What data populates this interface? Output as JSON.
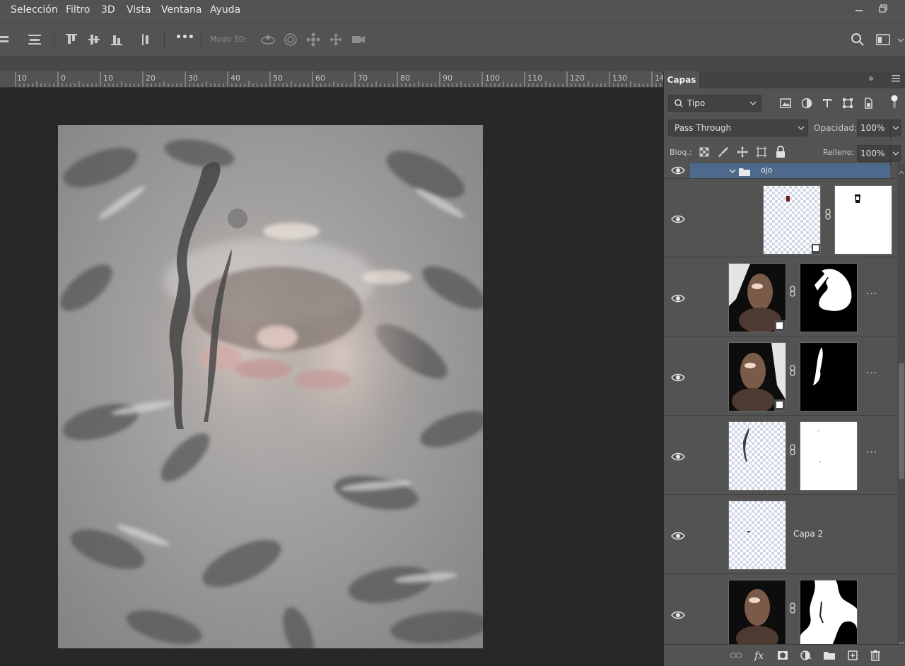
{
  "menu": {
    "items": [
      "Selección",
      "Filtro",
      "3D",
      "Vista",
      "Ventana",
      "Ayuda"
    ]
  },
  "window_controls": [
    "minimize-icon",
    "restore-icon"
  ],
  "options_bar": {
    "mode3d_label": "Modo 3D:",
    "more_label": "•••"
  },
  "ruler": {
    "labels": [
      "10",
      "0",
      "10",
      "20",
      "30",
      "40",
      "50",
      "60",
      "70",
      "80",
      "90",
      "100",
      "110",
      "120",
      "130",
      "14"
    ]
  },
  "layers_panel": {
    "tab_label": "Capas",
    "collapse_label": "»",
    "filter_label": "Tipo",
    "blend_mode": "Pass Through",
    "opacity_label": "Opacidad:",
    "opacity_value": "100%",
    "lock_label": "Bloq.:",
    "fill_label": "Relleno:",
    "fill_value": "100%",
    "group_name": "ojo",
    "layers": [
      {
        "name": "",
        "has_mask": true
      },
      {
        "name": "",
        "has_mask": true
      },
      {
        "name": "",
        "has_mask": true
      },
      {
        "name": "",
        "has_mask": true
      },
      {
        "name": "Capa 2",
        "has_mask": false
      },
      {
        "name": "",
        "has_mask": true
      }
    ],
    "more_label": "..."
  },
  "colors": {
    "panel_bg": "#535353",
    "canvas_bg": "#282828",
    "selected_row": "#4d6a8c"
  }
}
